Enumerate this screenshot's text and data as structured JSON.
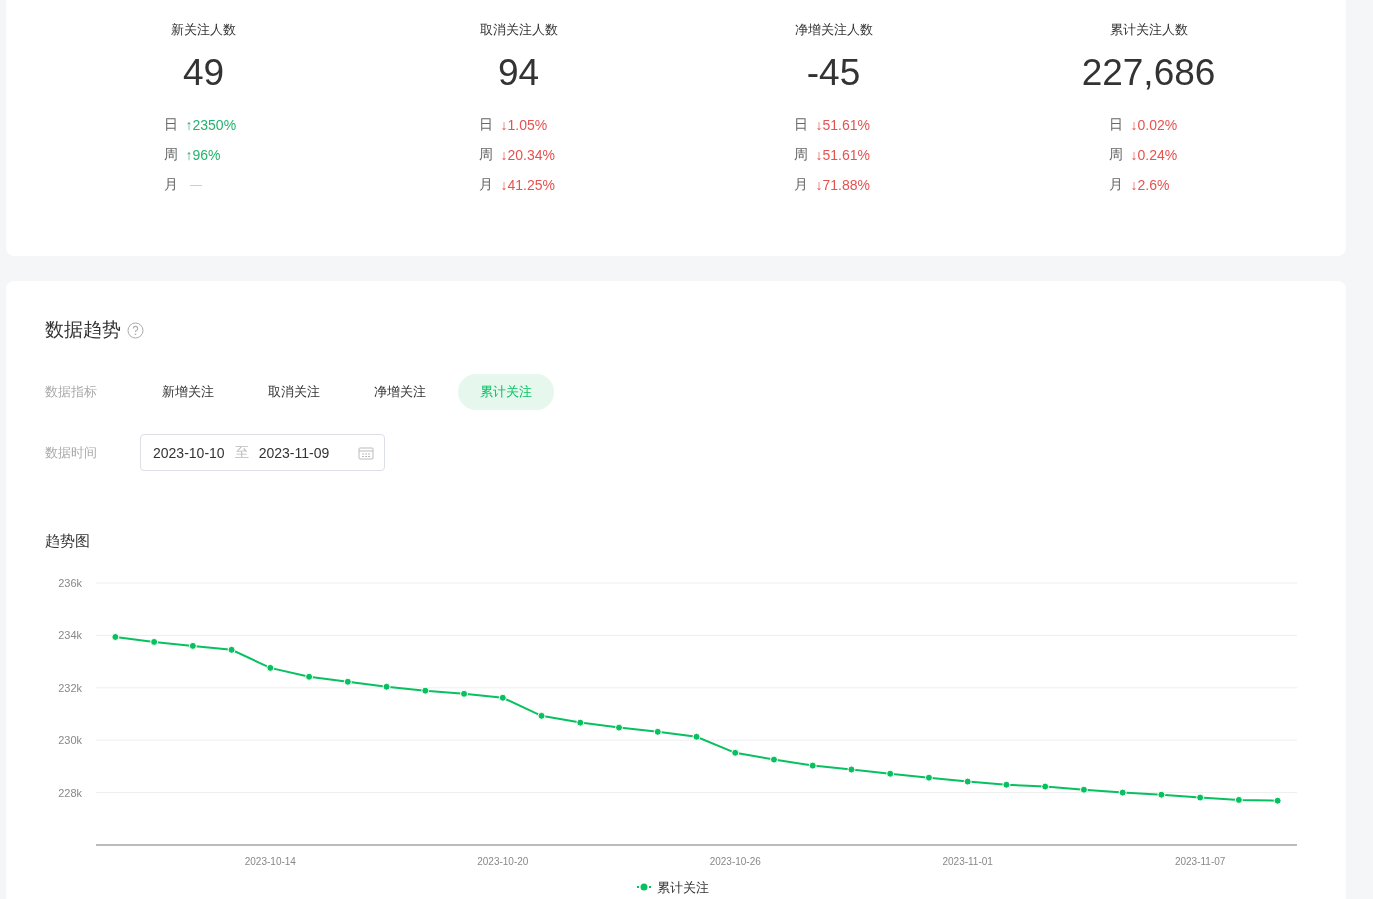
{
  "stats": [
    {
      "title": "新关注人数",
      "value": "49",
      "changes": [
        {
          "period": "日",
          "kind": "up",
          "value": "↑2350%"
        },
        {
          "period": "周",
          "kind": "up",
          "value": "↑96%"
        },
        {
          "period": "月",
          "kind": "flat"
        }
      ]
    },
    {
      "title": "取消关注人数",
      "value": "94",
      "changes": [
        {
          "period": "日",
          "kind": "down",
          "value": "↓1.05%"
        },
        {
          "period": "周",
          "kind": "down",
          "value": "↓20.34%"
        },
        {
          "period": "月",
          "kind": "down",
          "value": "↓41.25%"
        }
      ]
    },
    {
      "title": "净增关注人数",
      "value": "-45",
      "changes": [
        {
          "period": "日",
          "kind": "down",
          "value": "↓51.61%"
        },
        {
          "period": "周",
          "kind": "down",
          "value": "↓51.61%"
        },
        {
          "period": "月",
          "kind": "down",
          "value": "↓71.88%"
        }
      ]
    },
    {
      "title": "累计关注人数",
      "value": "227,686",
      "changes": [
        {
          "period": "日",
          "kind": "down",
          "value": "↓0.02%"
        },
        {
          "period": "周",
          "kind": "down",
          "value": "↓0.24%"
        },
        {
          "period": "月",
          "kind": "down",
          "value": "↓2.6%"
        }
      ]
    }
  ],
  "trend": {
    "title": "数据趋势",
    "metric_label": "数据指标",
    "metrics": [
      {
        "label": "新增关注",
        "selected": false
      },
      {
        "label": "取消关注",
        "selected": false
      },
      {
        "label": "净增关注",
        "selected": false
      },
      {
        "label": "累计关注",
        "selected": true
      }
    ],
    "date_label": "数据时间",
    "date_range": {
      "start": "2023-10-10",
      "separator": "至",
      "end": "2023-11-09"
    },
    "chart_title": "趋势图",
    "chart_data": {
      "type": "line",
      "categories": [
        null,
        null,
        null,
        null,
        "2023-10-14",
        null,
        null,
        null,
        null,
        null,
        "2023-10-20",
        null,
        null,
        null,
        null,
        null,
        "2023-10-26",
        null,
        null,
        null,
        null,
        null,
        "2023-11-01",
        null,
        null,
        null,
        null,
        null,
        "2023-11-07",
        null,
        null
      ],
      "series": [
        {
          "name": "累计关注",
          "color": "#07c160",
          "marker": true,
          "values": [
            233940,
            233750,
            233600,
            233450,
            232760,
            232420,
            232230,
            232040,
            231890,
            231770,
            231620,
            230930,
            230670,
            230480,
            230320,
            230130,
            229520,
            229260,
            229030,
            228880,
            228720,
            228570,
            228420,
            228300,
            228230,
            228110,
            228000,
            227920,
            227810,
            227720,
            227690
          ]
        }
      ],
      "grid": true,
      "ylim": [
        226000,
        236000
      ],
      "yticks": [
        {
          "value": 228000,
          "label": "228k"
        },
        {
          "value": 230000,
          "label": "230k"
        },
        {
          "value": 232000,
          "label": "232k"
        },
        {
          "value": 234000,
          "label": "234k"
        },
        {
          "value": 236000,
          "label": "236k"
        }
      ]
    }
  }
}
